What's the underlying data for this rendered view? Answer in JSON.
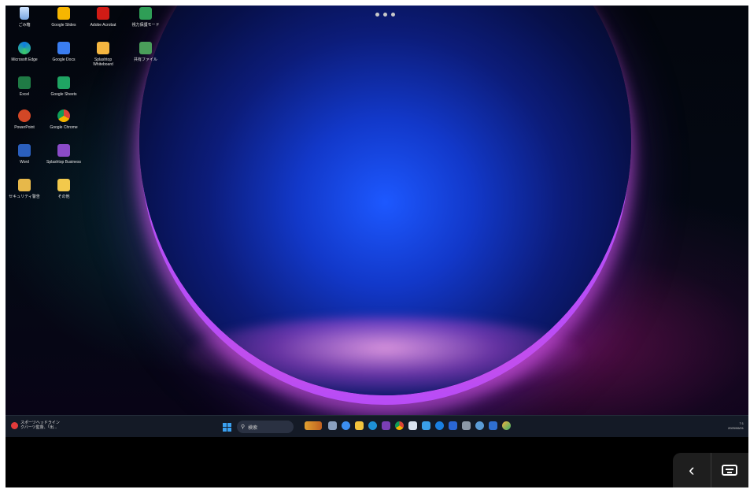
{
  "desktop": {
    "icons": [
      {
        "id": "recycle-bin",
        "label": "ごみ箱"
      },
      {
        "id": "google-slides",
        "label": "Google Slides"
      },
      {
        "id": "adobe-acrobat",
        "label": "Adobe Acrobat"
      },
      {
        "id": "vision-mode",
        "label": "視力保護モード"
      },
      {
        "id": "microsoft-edge",
        "label": "Microsoft Edge"
      },
      {
        "id": "google-docs",
        "label": "Google Docs"
      },
      {
        "id": "splashtop-whiteboard",
        "label": "Splashtop Whiteboard"
      },
      {
        "id": "shared-file",
        "label": "共有ファイル"
      },
      {
        "id": "excel",
        "label": "Excel"
      },
      {
        "id": "google-sheets",
        "label": "Google Sheets"
      },
      {
        "id": "powerpoint",
        "label": "PowerPoint"
      },
      {
        "id": "google-chrome",
        "label": "Google Chrome"
      },
      {
        "id": "word",
        "label": "Word"
      },
      {
        "id": "splashtop-business",
        "label": "Splashtop Business"
      },
      {
        "id": "security-warning",
        "label": "セキュリティ警告"
      },
      {
        "id": "misc-folder",
        "label": "その他"
      }
    ]
  },
  "taskbar": {
    "news": {
      "line1": "スポーツヘッドライン",
      "line2": "クバーツ監督、「出..."
    },
    "search_placeholder": "検索",
    "pinned": [
      "widgets",
      "file-explorer",
      "taskview",
      "folder",
      "edge",
      "onenote",
      "chrome",
      "snipping",
      "edge-2",
      "todo",
      "settings",
      "teams",
      "outlook",
      "paint"
    ],
    "tray": {
      "time": "7:1",
      "date": "2025/06/01"
    }
  },
  "controls": {
    "back_symbol": "‹"
  }
}
